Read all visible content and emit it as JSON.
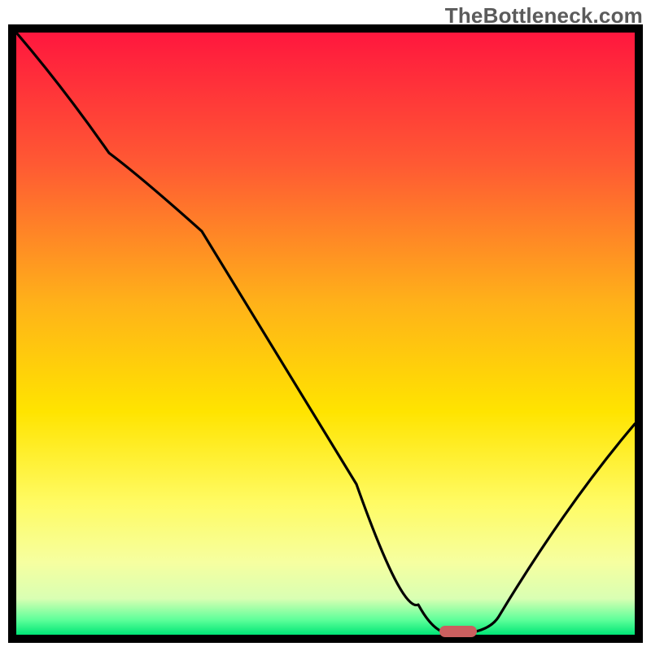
{
  "watermark": "TheBottleneck.com",
  "chart_data": {
    "type": "line",
    "title": "",
    "xlabel": "",
    "ylabel": "",
    "xlim": [
      0,
      100
    ],
    "ylim": [
      0,
      100
    ],
    "series": [
      {
        "name": "curve",
        "x": [
          0,
          15,
          30,
          55,
          65,
          70,
          73,
          78,
          100
        ],
        "y": [
          100,
          80,
          67,
          25,
          5,
          0,
          0,
          3,
          35
        ]
      }
    ],
    "marker": {
      "x": 71.5,
      "y": 0,
      "color": "#cb5f5f"
    },
    "gradient_stops": [
      {
        "offset": 0.0,
        "color": "#ff173e"
      },
      {
        "offset": 0.22,
        "color": "#ff5a33"
      },
      {
        "offset": 0.45,
        "color": "#ffb219"
      },
      {
        "offset": 0.63,
        "color": "#ffe400"
      },
      {
        "offset": 0.78,
        "color": "#fffb63"
      },
      {
        "offset": 0.88,
        "color": "#f6ffa0"
      },
      {
        "offset": 0.94,
        "color": "#d9ffb3"
      },
      {
        "offset": 0.975,
        "color": "#5fff9a"
      },
      {
        "offset": 1.0,
        "color": "#00e676"
      }
    ]
  }
}
